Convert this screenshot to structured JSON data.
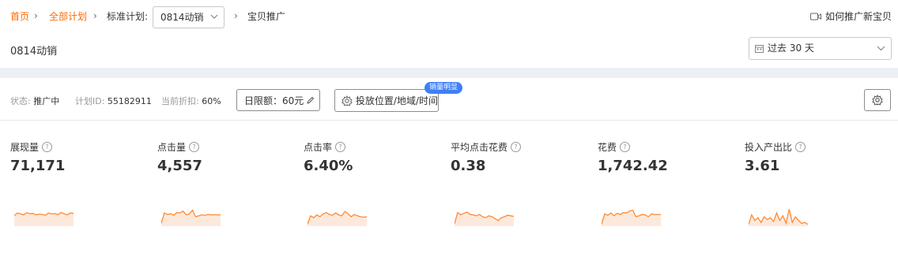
{
  "breadcrumb": {
    "home": "首页",
    "all_plans": "全部计划",
    "plan_type": "标准计划:",
    "plan_select": "0814动销",
    "current": "宝贝推广"
  },
  "howto_link": "如何推广新宝贝",
  "plan_name": "0814动销",
  "date_range": "过去 30 天",
  "status_bar": {
    "status_label": "状态:",
    "status_value": "推广中",
    "plan_id_label": "计划ID:",
    "plan_id_value": "55182911",
    "discount_label": "当前折扣:",
    "discount_value": "60%",
    "budget": "日限额：60元",
    "placement": "投放位置/地域/时间",
    "placement_tag": "销量明显"
  },
  "metrics": [
    {
      "label": "展现量",
      "value": "71,171",
      "spark": [
        0.55,
        0.7,
        0.65,
        0.6,
        0.72,
        0.66,
        0.68,
        0.6,
        0.64,
        0.62,
        0.58,
        0.7,
        0.64,
        0.67,
        0.61,
        0.73,
        0.65,
        0.6,
        0.7,
        0.68
      ]
    },
    {
      "label": "点击量",
      "value": "4,557",
      "spark": [
        0.15,
        0.7,
        0.62,
        0.66,
        0.58,
        0.72,
        0.7,
        0.8,
        0.6,
        0.65,
        0.85,
        0.5,
        0.55,
        0.6,
        0.58,
        0.62,
        0.6,
        0.61,
        0.6,
        0.6
      ]
    },
    {
      "label": "点击率",
      "value": "6.40%",
      "spark": [
        0.1,
        0.55,
        0.45,
        0.6,
        0.5,
        0.65,
        0.72,
        0.62,
        0.58,
        0.7,
        0.6,
        0.55,
        0.78,
        0.65,
        0.5,
        0.62,
        0.55,
        0.5,
        0.48,
        0.5
      ]
    },
    {
      "label": "平均点击花费",
      "value": "0.38",
      "spark": [
        0.12,
        0.72,
        0.6,
        0.68,
        0.75,
        0.62,
        0.6,
        0.55,
        0.62,
        0.5,
        0.45,
        0.55,
        0.5,
        0.4,
        0.3,
        0.45,
        0.5,
        0.58,
        0.55,
        0.52
      ]
    },
    {
      "label": "花费",
      "value": "1,742.42",
      "spark": [
        0.1,
        0.65,
        0.58,
        0.7,
        0.55,
        0.68,
        0.62,
        0.72,
        0.7,
        0.8,
        0.85,
        0.5,
        0.55,
        0.62,
        0.6,
        0.5,
        0.65,
        0.62,
        0.62,
        0.62
      ]
    },
    {
      "label": "投入产出比",
      "value": "3.61",
      "spark": [
        0.1,
        0.6,
        0.3,
        0.45,
        0.2,
        0.5,
        0.35,
        0.45,
        0.25,
        0.7,
        0.3,
        0.55,
        0.15,
        0.9,
        0.2,
        0.5,
        0.3,
        0.15,
        0.2,
        0.1
      ]
    }
  ],
  "colors": {
    "accent": "#ff6a00",
    "spark_line": "#ff8a33",
    "spark_fill": "#fde9dc",
    "tag_bg": "#3f7ff5"
  }
}
